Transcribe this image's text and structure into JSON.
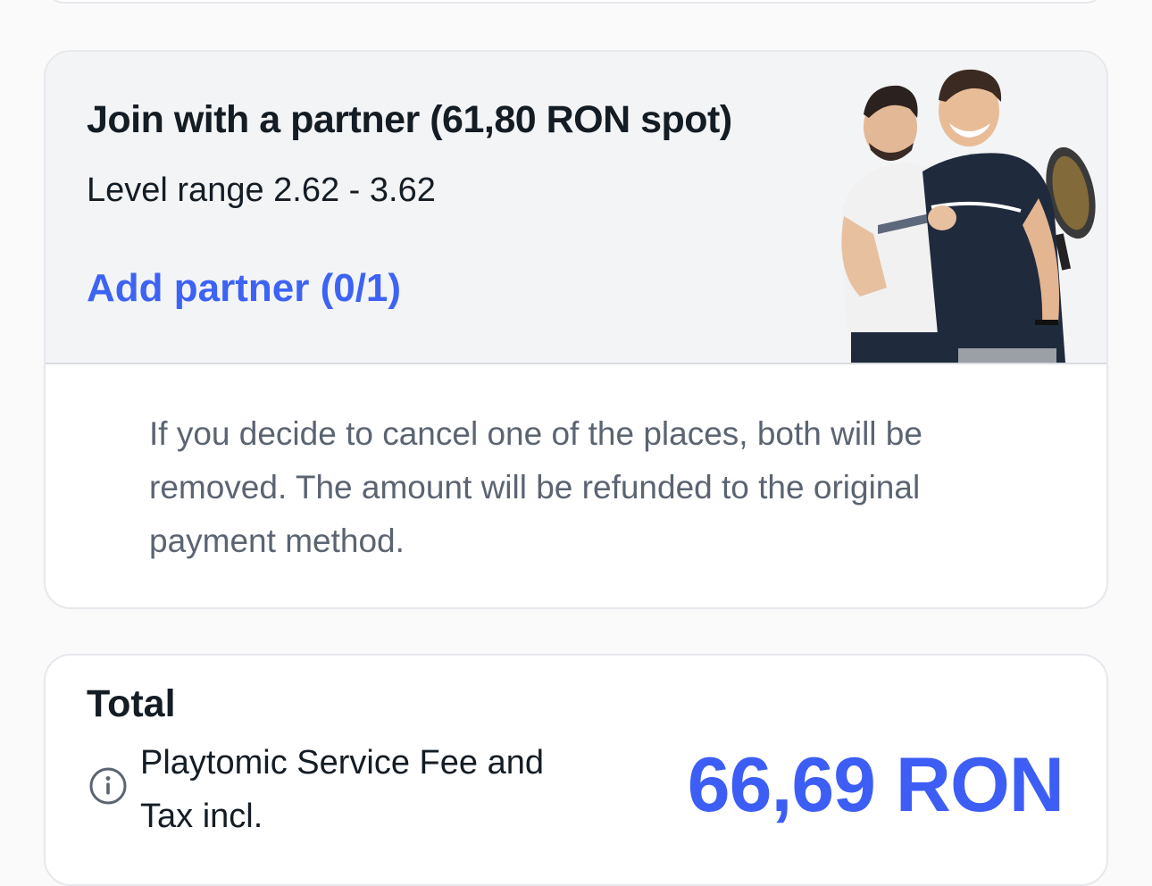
{
  "partner_card": {
    "title": "Join with a partner (61,80 RON spot)",
    "level_range": "Level range 2.62 - 3.62",
    "add_partner_label": "Add partner (0/1)",
    "cancel_note": "If you decide to cancel one of the places, both will be removed. The amount will be refunded to the original payment method.",
    "photo_icon": "padel-players-image"
  },
  "total_card": {
    "label": "Total",
    "fee_note": "Playtomic Service Fee and Tax incl.",
    "price": "66,69 RON",
    "info_icon": "info-icon"
  },
  "colors": {
    "accent": "#3d63f5",
    "text_primary": "#141c24",
    "text_secondary": "#5b6471",
    "card_top_bg": "#f3f4f6"
  }
}
